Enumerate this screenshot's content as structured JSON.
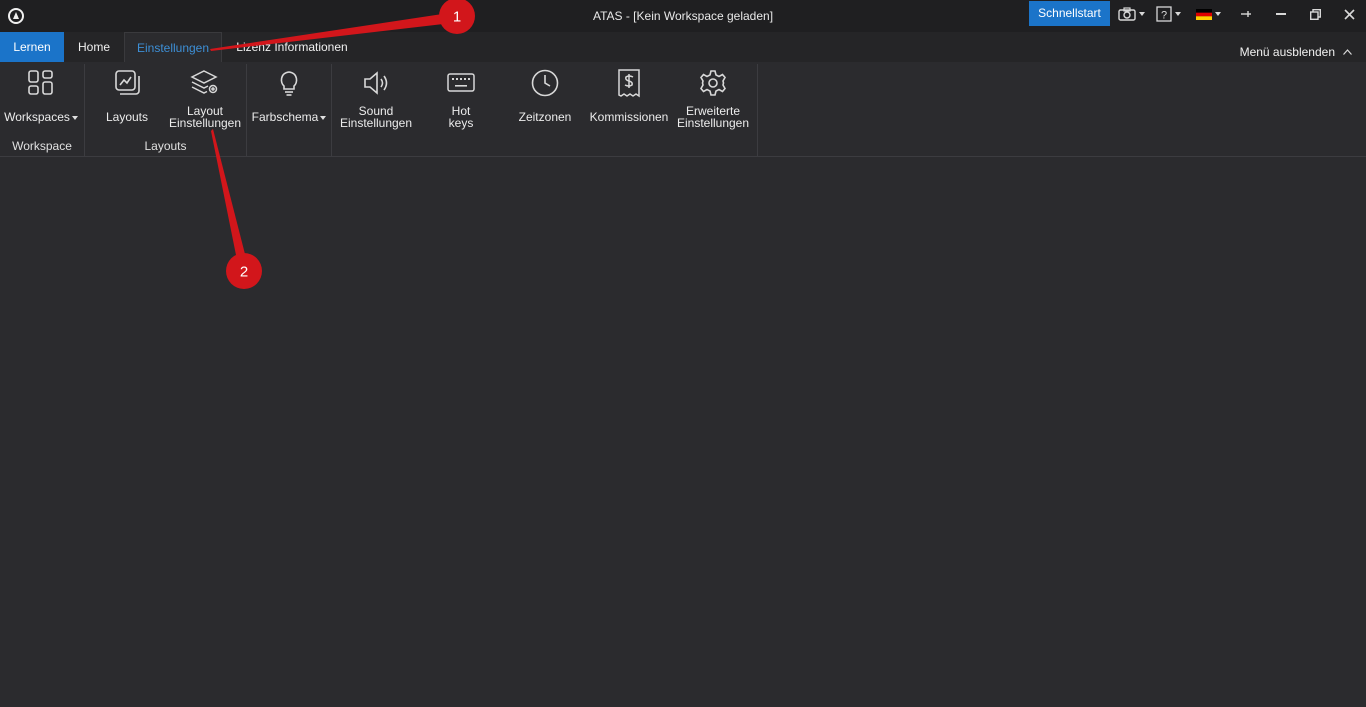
{
  "window": {
    "title": "ATAS - [Kein Workspace geladen]"
  },
  "toolbar": {
    "quickstart_label": "Schnellstart"
  },
  "tabs": [
    {
      "label": "Lernen"
    },
    {
      "label": "Home"
    },
    {
      "label": "Einstellungen"
    },
    {
      "label": "Lizenz Informationen"
    }
  ],
  "hide_menu_label": "Menü ausblenden",
  "ribbon": {
    "workspaces": {
      "label": "Workspaces"
    },
    "layouts": {
      "label": "Layouts"
    },
    "layout_settings": {
      "line1": "Layout",
      "line2": "Einstellungen"
    },
    "color_scheme": {
      "label": "Farbschema"
    },
    "sound_settings": {
      "line1": "Sound",
      "line2": "Einstellungen"
    },
    "hotkeys": {
      "line1": "Hot",
      "line2": "keys"
    },
    "timezones": {
      "label": "Zeitzonen"
    },
    "commissions": {
      "label": "Kommissionen"
    },
    "advanced": {
      "line1": "Erweiterte",
      "line2": "Einstellungen"
    },
    "groups": {
      "workspace": "Workspace",
      "layouts": "Layouts"
    }
  },
  "annotations": {
    "marker1": "1",
    "marker2": "2"
  },
  "colors": {
    "accent": "#1b74c9",
    "background": "#2b2b2e",
    "annotation": "#d2161b"
  },
  "icons": [
    "app-logo-icon",
    "camera-icon",
    "help-icon",
    "german-flag-icon",
    "pin-icon",
    "minimize-icon",
    "maximize-icon",
    "close-icon"
  ]
}
